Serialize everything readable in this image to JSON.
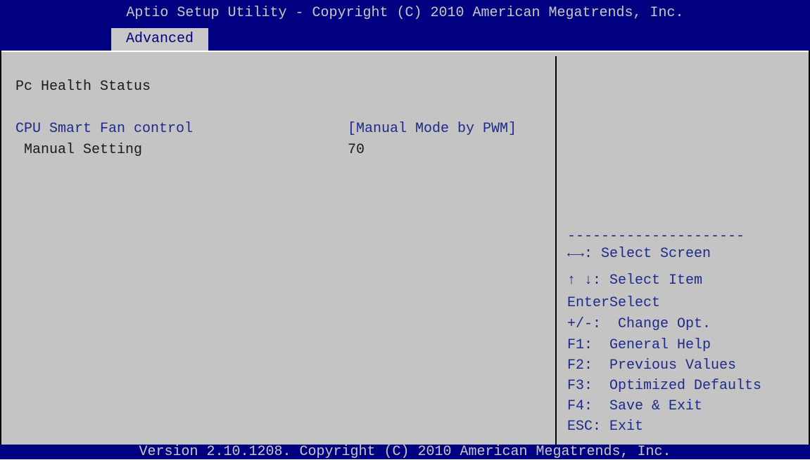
{
  "title": "Aptio Setup Utility - Copyright (C) 2010 American Megatrends, Inc.",
  "tabs": [
    {
      "label": "Advanced",
      "active": true
    }
  ],
  "section_title": "Pc Health Status",
  "settings": [
    {
      "label": "CPU Smart Fan control",
      "value": "[Manual Mode by PWM]"
    },
    {
      "label": " Manual Setting",
      "value": "70"
    }
  ],
  "help": {
    "separator": "---------------------",
    "items": [
      {
        "key": "←→:",
        "desc": " Select Screen"
      },
      {
        "key": "↑ ↓:",
        "desc": " Select Item"
      },
      {
        "key": "Enter",
        "desc": "Select"
      },
      {
        "key": "+/-:",
        "desc": "  Change Opt."
      },
      {
        "key": "F1:",
        "desc": "  General Help"
      },
      {
        "key": "F2:",
        "desc": "  Previous Values"
      },
      {
        "key": "F3:",
        "desc": "  Optimized Defaults"
      },
      {
        "key": "F4:",
        "desc": "  Save & Exit"
      },
      {
        "key": "ESC:",
        "desc": " Exit"
      }
    ]
  },
  "footer": "Version 2.10.1208. Copyright (C) 2010 American Megatrends, Inc.",
  "colors": {
    "header_bg": "#000080",
    "panel_bg": "#c4c4c4",
    "highlight_text": "#1e2a8a"
  }
}
